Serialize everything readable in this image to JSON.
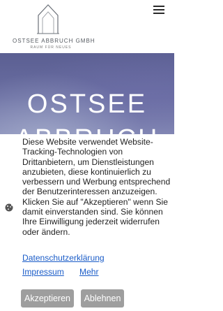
{
  "header": {
    "logo_name": "OSTSEE ABBRUCH GMBH",
    "logo_tagline": "RAUM FÜR NEUES",
    "menu_icon": "hamburger-menu-icon"
  },
  "hero": {
    "title": "OSTSEE ABBRUCH"
  },
  "cookie_banner": {
    "icon": "cookie-icon",
    "text": "Diese Website verwendet Website-Tracking-Technologien von Drittanbietern, um Dienstleistungen anzubieten, diese kontinuierlich zu verbessern und Werbung entsprechend der Benutzerinteressen anzuzeigen. Klicken Sie auf \"Akzeptieren\" wenn Sie damit einverstanden sind. Sie können Ihre Einwilligung jederzeit widerrufen oder ändern.",
    "privacy_link": "Datenschutzerklärung",
    "imprint_link": "Impressum",
    "more_link": "Mehr",
    "accept_label": "Akzeptieren",
    "decline_label": "Ablehnen"
  },
  "colors": {
    "link": "#1a5cc8",
    "button": "#9e9e9e",
    "hero": "#6a6ea2"
  }
}
